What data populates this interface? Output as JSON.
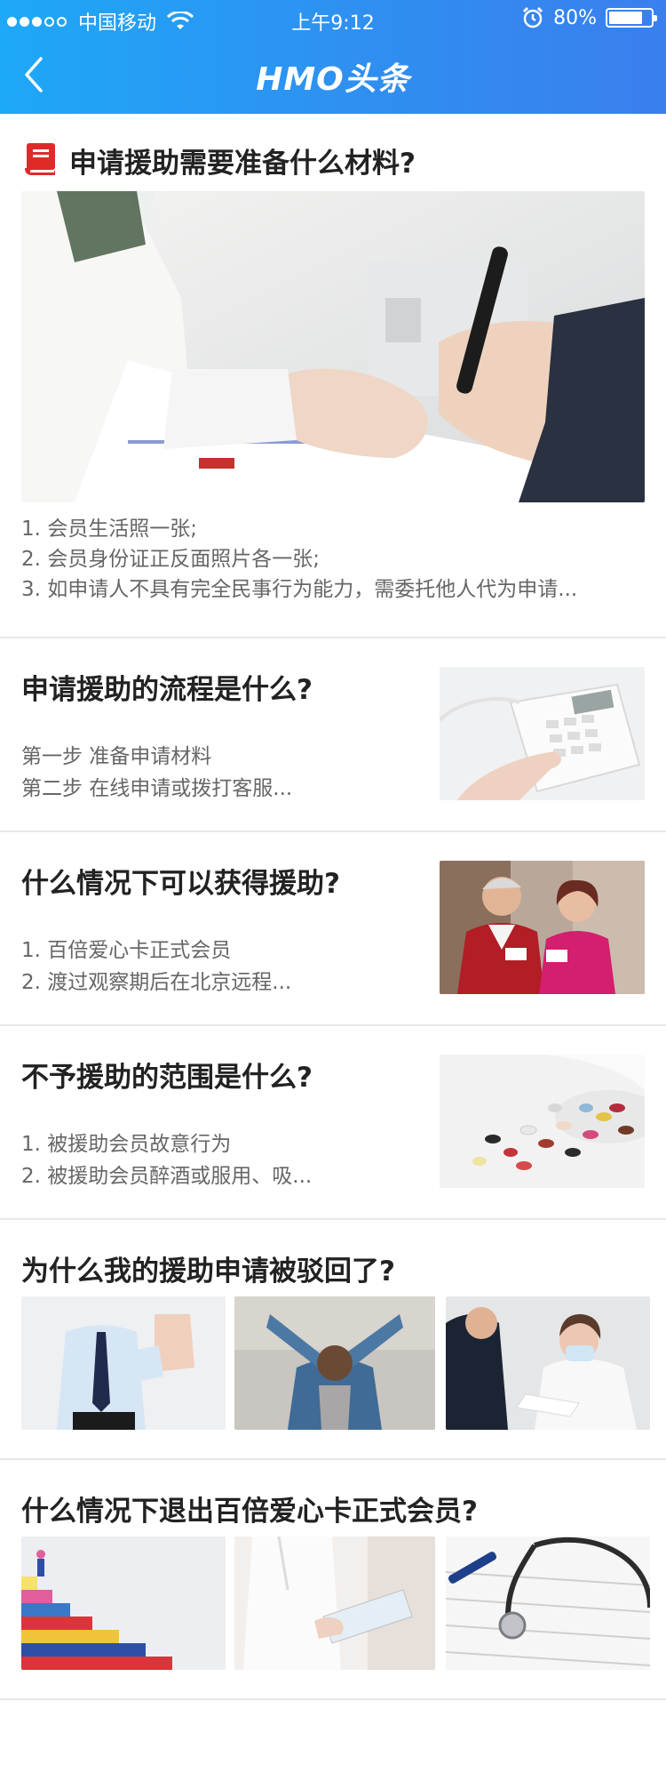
{
  "status_bar": {
    "carrier": "中国移动",
    "time": "上午9:12",
    "battery": "80%",
    "battery_level": 0.8
  },
  "nav": {
    "title": "HMO头条",
    "back_icon": "chevron-left-icon"
  },
  "articles": [
    {
      "title": "申请援助需要准备什么材料?",
      "icon": "book-icon",
      "lines": [
        "1. 会员生活照一张;",
        "2. 会员身份证正反面照片各一张;",
        "3. 如申请人不具有完全民事行为能力，需委托他人代为申请..."
      ]
    },
    {
      "title": "申请援助的流程是什么?",
      "lines": [
        "第一步 准备申请材料",
        "第二步 在线申请或拨打客服..."
      ]
    },
    {
      "title": "什么情况下可以获得援助?",
      "lines": [
        "1. 百倍爱心卡正式会员",
        "2. 渡过观察期后在北京远程..."
      ]
    },
    {
      "title": "不予援助的范围是什么?",
      "lines": [
        "1. 被援助会员故意行为",
        "2. 被援助会员醉酒或服用、吸..."
      ]
    },
    {
      "title": "为什么我的援助申请被驳回了?"
    },
    {
      "title": "什么情况下退出百倍爱心卡正式会员?"
    }
  ]
}
